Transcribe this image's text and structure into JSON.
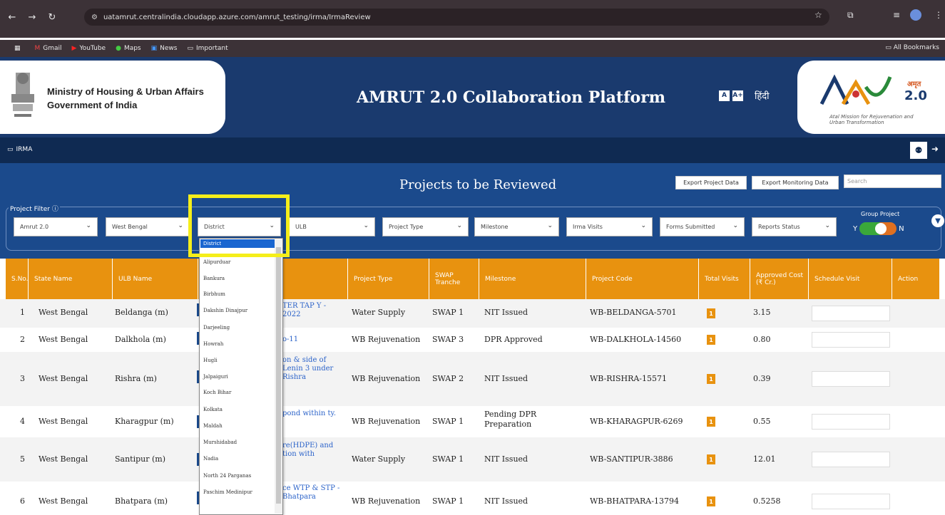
{
  "browser": {
    "url": "uatamrut.centralindia.cloudapp.azure.com/amrut_testing/irma/IrmaReview",
    "bookmarks": [
      "Gmail",
      "YouTube",
      "Maps",
      "News",
      "Important"
    ],
    "all_bookmarks": "All Bookmarks"
  },
  "header": {
    "ministry_line1": "Ministry of Housing & Urban Affairs",
    "ministry_line2": "Government of India",
    "title": "AMRUT 2.0 Collaboration Platform",
    "font_small": "A",
    "font_large": "A+",
    "hindi": "हिंदी",
    "logo_hindi": "अमृत",
    "logo_version": "2.0",
    "logo_tagline": "Atal Mission for Rejuvenation and Urban Transformation"
  },
  "nav": {
    "section": "IRMA"
  },
  "main": {
    "page_title": "Projects to be Reviewed",
    "export_project": "Export Project Data",
    "export_monitoring": "Export Monitoring Data",
    "search_placeholder": "Search",
    "filter_label": "Project Filter",
    "group_project": "Group Project",
    "toggle_y": "Y",
    "toggle_n": "N"
  },
  "filters": [
    "Amrut 2.0",
    "West Bengal",
    "District",
    "ULB",
    "Project Type",
    "Milestone",
    "Irma Visits",
    "Forms Submitted",
    "Reports Status"
  ],
  "dropdown": {
    "selected": "District",
    "options": [
      "Alipurduar",
      "Bankura",
      "Birbhum",
      "Dakshin Dinajpur",
      "Darjeeling",
      "Howrah",
      "Hugli",
      "Jalpaiguri",
      "Koch Bihar",
      "Kolkata",
      "Maldah",
      "Murshidabad",
      "Nadia",
      "North 24 Parganas",
      "Paschim Medinipur"
    ]
  },
  "table": {
    "headers": [
      "S.No.",
      "State Name",
      "ULB Name",
      "",
      "Project Type",
      "SWAP Tranche",
      "Milestone",
      "Project Code",
      "Total Visits",
      "Approved Cost (₹ Cr.)",
      "Schedule Visit",
      "Action"
    ],
    "rows": [
      {
        "sno": "1",
        "state": "West Bengal",
        "ulb": "Beldanga (m)",
        "name": "TER TAP Y - 2022",
        "type": "Water Supply",
        "swap": "SWAP 1",
        "milestone": "NIT Issued",
        "code": "WB-BELDANGA-5701",
        "visits": "1",
        "cost": "3.15"
      },
      {
        "sno": "2",
        "state": "West Bengal",
        "ulb": "Dalkhola (m)",
        "name": "o-11",
        "type": "WB Rejuvenation",
        "swap": "SWAP 3",
        "milestone": "DPR Approved",
        "code": "WB-DALKHOLA-14560",
        "visits": "1",
        "cost": "0.80"
      },
      {
        "sno": "3",
        "state": "West Bengal",
        "ulb": "Rishra (m)",
        "name": "on & side of Lenin 3 under Rishra",
        "type": "WB Rejuvenation",
        "swap": "SWAP 2",
        "milestone": "NIT Issued",
        "code": "WB-RISHRA-15571",
        "visits": "1",
        "cost": "0.39"
      },
      {
        "sno": "4",
        "state": "West Bengal",
        "ulb": "Kharagpur (m)",
        "name": "pond within ty.",
        "type": "WB Rejuvenation",
        "swap": "SWAP 1",
        "milestone": "Pending DPR Preparation",
        "code": "WB-KHARAGPUR-6269",
        "visits": "1",
        "cost": "0.55"
      },
      {
        "sno": "5",
        "state": "West Bengal",
        "ulb": "Santipur (m)",
        "name": "re(HDPE) and tion with",
        "type": "Water Supply",
        "swap": "SWAP 1",
        "milestone": "NIT Issued",
        "code": "WB-SANTIPUR-3886",
        "visits": "1",
        "cost": "12.01"
      },
      {
        "sno": "6",
        "state": "West Bengal",
        "ulb": "Bhatpara (m)",
        "name": "ce WTP & STP - Bhatpara",
        "type": "WB Rejuvenation",
        "swap": "SWAP 1",
        "milestone": "NIT Issued",
        "code": "WB-BHATPARA-13794",
        "visits": "1",
        "cost": "0.5258"
      }
    ]
  }
}
